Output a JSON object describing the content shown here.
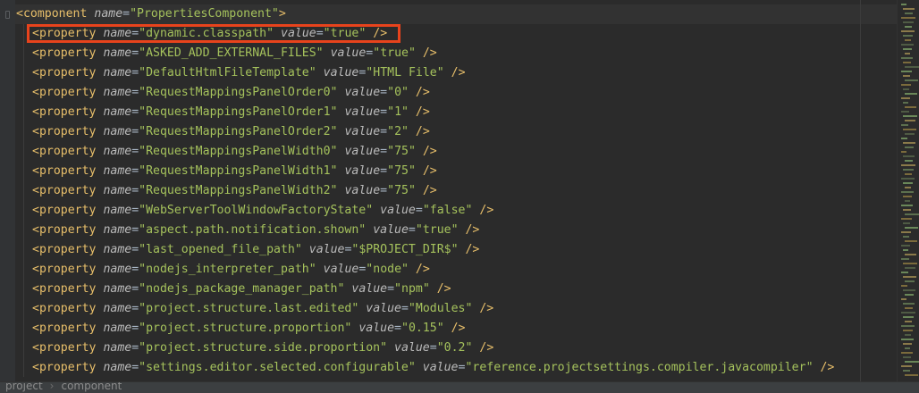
{
  "component": {
    "tag": "component",
    "attr": "name",
    "value": "PropertiesComponent"
  },
  "properties": [
    {
      "name": "dynamic.classpath",
      "value": "true"
    },
    {
      "name": "ASKED_ADD_EXTERNAL_FILES",
      "value": "true"
    },
    {
      "name": "DefaultHtmlFileTemplate",
      "value": "HTML File"
    },
    {
      "name": "RequestMappingsPanelOrder0",
      "value": "0"
    },
    {
      "name": "RequestMappingsPanelOrder1",
      "value": "1"
    },
    {
      "name": "RequestMappingsPanelOrder2",
      "value": "2"
    },
    {
      "name": "RequestMappingsPanelWidth0",
      "value": "75"
    },
    {
      "name": "RequestMappingsPanelWidth1",
      "value": "75"
    },
    {
      "name": "RequestMappingsPanelWidth2",
      "value": "75"
    },
    {
      "name": "WebServerToolWindowFactoryState",
      "value": "false"
    },
    {
      "name": "aspect.path.notification.shown",
      "value": "true"
    },
    {
      "name": "last_opened_file_path",
      "value": "$PROJECT_DIR$"
    },
    {
      "name": "nodejs_interpreter_path",
      "value": "node"
    },
    {
      "name": "nodejs_package_manager_path",
      "value": "npm"
    },
    {
      "name": "project.structure.last.edited",
      "value": "Modules"
    },
    {
      "name": "project.structure.proportion",
      "value": "0.15"
    },
    {
      "name": "project.structure.side.proportion",
      "value": "0.2"
    },
    {
      "name": "settings.editor.selected.configurable",
      "value": "reference.projectsettings.compiler.javacompiler"
    }
  ],
  "property_tag": "property",
  "property_name_attr": "name",
  "property_value_attr": "value",
  "highlighted_index": 0,
  "breadcrumb": [
    "project",
    "component"
  ],
  "colors": {
    "background": "#2b2b2b",
    "tag": "#e8bf6a",
    "attribute": "#bababa",
    "string": "#a5c25c",
    "highlight_box": "#e8431c"
  }
}
